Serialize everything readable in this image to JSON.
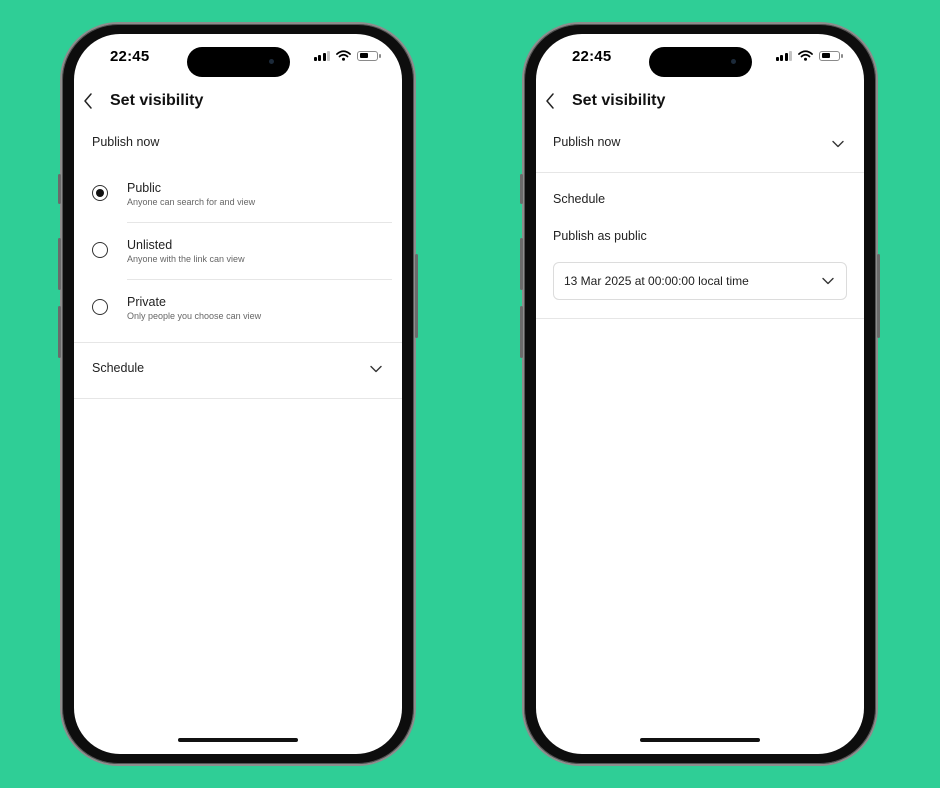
{
  "theme": {
    "background": "#2fce96"
  },
  "left_phone": {
    "status": {
      "time": "22:45"
    },
    "header": {
      "title": "Set visibility",
      "back_icon": "chevron-left-icon"
    },
    "publish_now": {
      "label": "Publish now"
    },
    "options": [
      {
        "title": "Public",
        "subtitle": "Anyone can search for and view",
        "selected": true
      },
      {
        "title": "Unlisted",
        "subtitle": "Anyone with the link can view",
        "selected": false
      },
      {
        "title": "Private",
        "subtitle": "Only people you choose can view",
        "selected": false
      }
    ],
    "schedule": {
      "label": "Schedule",
      "icon": "chevron-down-icon"
    }
  },
  "right_phone": {
    "status": {
      "time": "22:45"
    },
    "header": {
      "title": "Set visibility",
      "back_icon": "chevron-left-icon"
    },
    "publish_now": {
      "label": "Publish now",
      "icon": "chevron-down-icon"
    },
    "schedule": {
      "label": "Schedule",
      "publish_as": "Publish as public",
      "datetime": "13 Mar 2025 at 00:00:00 local time"
    }
  }
}
